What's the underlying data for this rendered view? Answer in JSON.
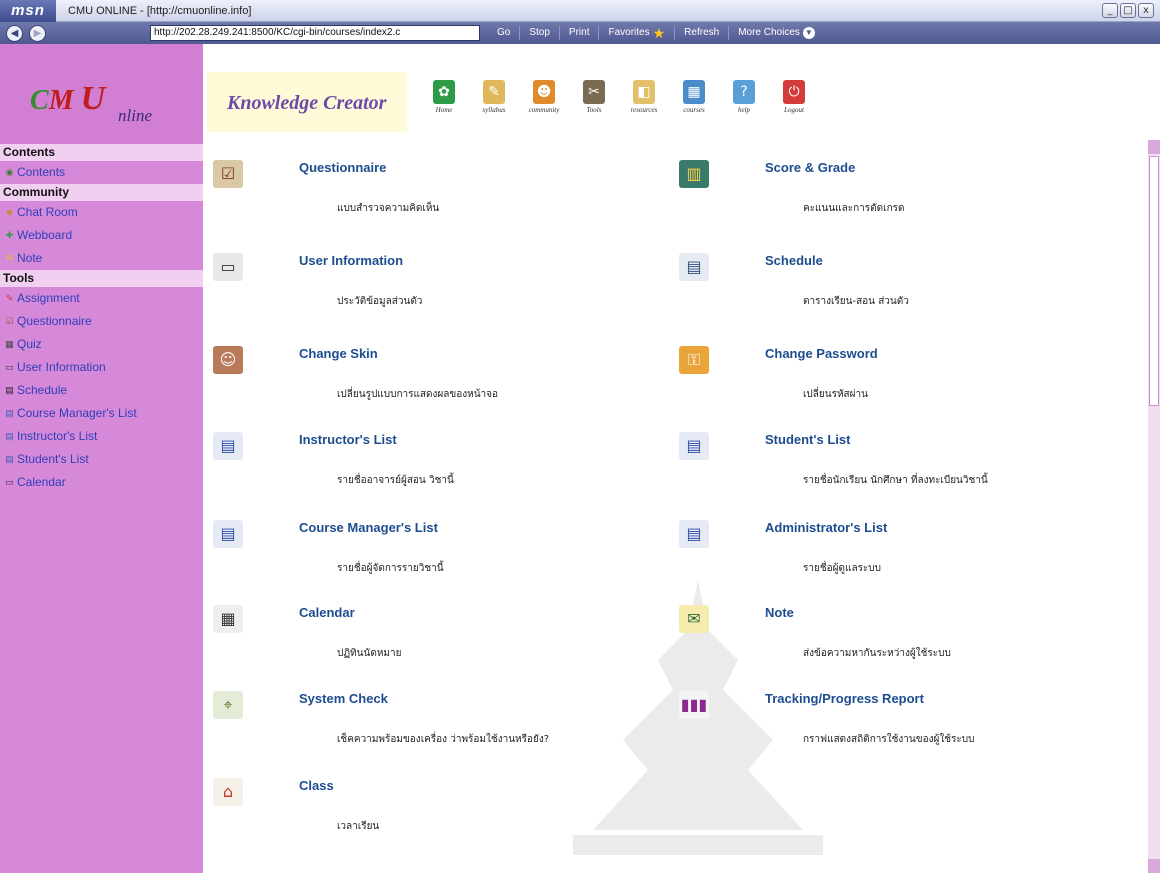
{
  "window": {
    "brand": "msn",
    "title": "CMU ONLINE - [http://cmuonline.info]",
    "controls": [
      "_",
      "□",
      "x"
    ]
  },
  "toolbar": {
    "address": "http://202.28.249.241:8500/KC/cgi-bin/courses/index2.c",
    "buttons": [
      "Go",
      "Stop",
      "Print",
      "Favorites",
      "Refresh",
      "More Choices"
    ]
  },
  "sidebar": {
    "logo": {
      "c": "C",
      "m": "M",
      "u": "U",
      "online": "nline"
    },
    "sections": [
      {
        "heading": "Contents",
        "items": [
          {
            "label": "Contents",
            "icon": "contents-icon"
          }
        ]
      },
      {
        "heading": "Community",
        "items": [
          {
            "label": "Chat Room",
            "icon": "chat-icon"
          },
          {
            "label": "Webboard",
            "icon": "webboard-icon"
          },
          {
            "label": "Note",
            "icon": "note-icon"
          }
        ]
      },
      {
        "heading": "Tools",
        "items": [
          {
            "label": "Assignment",
            "icon": "assignment-icon"
          },
          {
            "label": "Questionnaire",
            "icon": "questionnaire-icon"
          },
          {
            "label": "Quiz",
            "icon": "quiz-icon"
          },
          {
            "label": "User Information",
            "icon": "user-info-icon"
          },
          {
            "label": "Schedule",
            "icon": "schedule-icon"
          },
          {
            "label": "Course Manager's List",
            "icon": "list-icon"
          },
          {
            "label": "Instructor's List",
            "icon": "list-icon"
          },
          {
            "label": "Student's List",
            "icon": "list-icon"
          },
          {
            "label": "Calendar",
            "icon": "calendar-icon"
          }
        ]
      }
    ]
  },
  "banner": {
    "title": "Knowledge Creator",
    "icons": [
      {
        "label": "Home",
        "icon": "home-icon",
        "color": "#2e9b48"
      },
      {
        "label": "syllabus",
        "icon": "syllabus-icon",
        "color": "#e0b85a"
      },
      {
        "label": "community",
        "icon": "community-icon",
        "color": "#e08a2a"
      },
      {
        "label": "Tools",
        "icon": "tools-icon",
        "color": "#7b6a52"
      },
      {
        "label": "resources",
        "icon": "resources-icon",
        "color": "#e3c16a"
      },
      {
        "label": "courses",
        "icon": "courses-icon",
        "color": "#4a8cc9"
      },
      {
        "label": "help",
        "icon": "help-icon",
        "color": "#5aa0d8"
      },
      {
        "label": "Logout",
        "icon": "logout-icon",
        "color": "#d33a3a"
      }
    ]
  },
  "entries": [
    {
      "title": "Questionnaire",
      "desc": "แบบสำรวจความคิดเห็น",
      "icon": "questionnaire-icon"
    },
    {
      "title": "Score & Grade",
      "desc": "คะแนนและการตัดเกรด",
      "icon": "score-grade-icon"
    },
    {
      "title": "User Information",
      "desc": "ประวัติข้อมูลส่วนตัว",
      "icon": "user-info-icon"
    },
    {
      "title": "Schedule",
      "desc": "ตารางเรียน-สอน ส่วนตัว",
      "icon": "schedule-icon"
    },
    {
      "title": "Change Skin",
      "desc": "เปลี่ยนรูปแบบการแสดงผลของหน้าจอ",
      "icon": "change-skin-icon"
    },
    {
      "title": "Change Password",
      "desc": "เปลี่ยนรหัสผ่าน",
      "icon": "change-password-icon"
    },
    {
      "title": "Instructor's List",
      "desc": "รายชื่ออาจารย์ผู้สอน วิชานี้",
      "icon": "list-icon"
    },
    {
      "title": "Student's List",
      "desc": "รายชื่อนักเรียน นักศึกษา ที่ลงทะเบียนวิชานี้",
      "icon": "list-icon"
    },
    {
      "title": "Course Manager's List",
      "desc": "รายชื่อผู้จัดการรายวิชานี้",
      "icon": "list-icon"
    },
    {
      "title": "Administrator's List",
      "desc": "รายชื่อผู้ดูแลระบบ",
      "icon": "list-icon"
    },
    {
      "title": "Calendar",
      "desc": "ปฏิทินนัดหมาย",
      "icon": "calendar-icon"
    },
    {
      "title": "Note",
      "desc": "ส่งข้อความหากันระหว่างผู้ใช้ระบบ",
      "icon": "note-icon"
    },
    {
      "title": "System Check",
      "desc": "เช็คความพร้อมของเครื่อง ว่าพร้อมใช้งานหรือยัง?",
      "icon": "system-check-icon"
    },
    {
      "title": "Tracking/Progress Report",
      "desc": "กราฟแสดงสถิติการใช้งานของผู้ใช้ระบบ",
      "icon": "chart-icon"
    },
    {
      "title": "Class",
      "desc": "เวลาเรียน",
      "icon": "class-icon"
    }
  ]
}
